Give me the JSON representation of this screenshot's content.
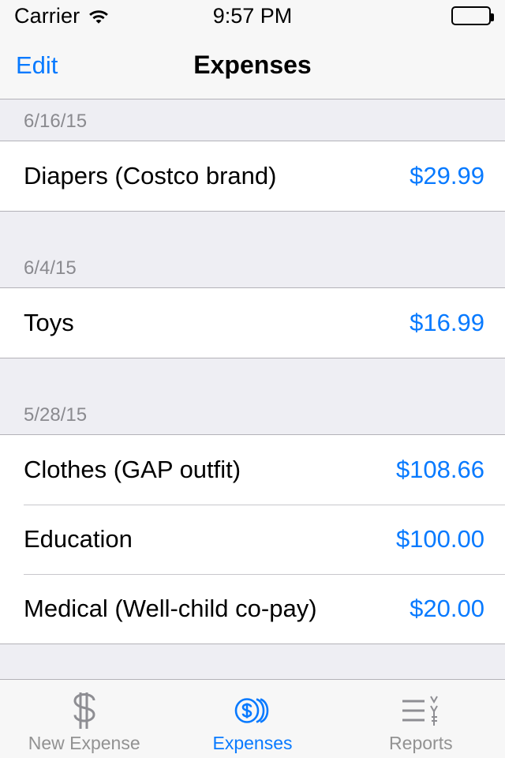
{
  "status_bar": {
    "carrier": "Carrier",
    "wifi_icon": "wifi-icon",
    "time": "9:57 PM",
    "battery_icon": "battery-full-icon"
  },
  "nav_bar": {
    "edit_label": "Edit",
    "title": "Expenses"
  },
  "colors": {
    "accent": "#087aff",
    "section_bg": "#eeeef3",
    "separator": "#c8c7cc",
    "inactive_tab": "#929292"
  },
  "list": {
    "sections": [
      {
        "date": "6/16/15",
        "rows": [
          {
            "title": "Diapers (Costco brand)",
            "amount": "$29.99"
          }
        ]
      },
      {
        "date": "6/4/15",
        "rows": [
          {
            "title": "Toys",
            "amount": "$16.99"
          }
        ]
      },
      {
        "date": "5/28/15",
        "rows": [
          {
            "title": "Clothes (GAP outfit)",
            "amount": "$108.66"
          },
          {
            "title": "Education",
            "amount": "$100.00"
          },
          {
            "title": "Medical (Well-child co-pay)",
            "amount": "$20.00"
          }
        ]
      }
    ]
  },
  "tab_bar": {
    "tabs": [
      {
        "label": "New Expense",
        "icon": "dollar-sign-icon",
        "active": false
      },
      {
        "label": "Expenses",
        "icon": "coins-stack-icon",
        "active": true
      },
      {
        "label": "Reports",
        "icon": "report-lines-icon",
        "active": false
      }
    ]
  }
}
